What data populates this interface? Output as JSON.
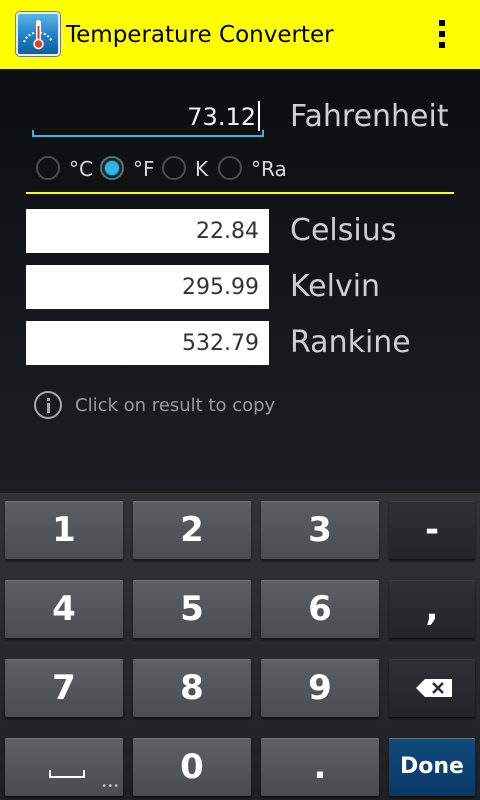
{
  "actionbar": {
    "title": "Temperature Converter",
    "icon": "thermometer-gauge-icon",
    "overflow_icon": "overflow-menu-icon",
    "background": "#ffff00"
  },
  "input": {
    "value": "73.12",
    "unit_label": "Fahrenheit",
    "accent_color": "#33b5e5"
  },
  "scale_options": [
    {
      "label": "°C",
      "checked": false
    },
    {
      "label": "°F",
      "checked": true
    },
    {
      "label": "K",
      "checked": false
    },
    {
      "label": "°Ra",
      "checked": false
    }
  ],
  "results": [
    {
      "value": "22.84",
      "unit": "Celsius"
    },
    {
      "value": "295.99",
      "unit": "Kelvin"
    },
    {
      "value": "532.79",
      "unit": "Rankine"
    }
  ],
  "hint": {
    "icon": "info-icon",
    "text": "Click on result to copy"
  },
  "keyboard": {
    "rows": [
      [
        "1",
        "2",
        "3",
        "-"
      ],
      [
        "4",
        "5",
        "6",
        ","
      ],
      [
        "7",
        "8",
        "9",
        "backspace"
      ],
      [
        "space",
        "0",
        ".",
        "Done"
      ]
    ],
    "done_label": "Done",
    "backspace_icon": "backspace-icon",
    "space_icon": "space-bar-icon"
  }
}
